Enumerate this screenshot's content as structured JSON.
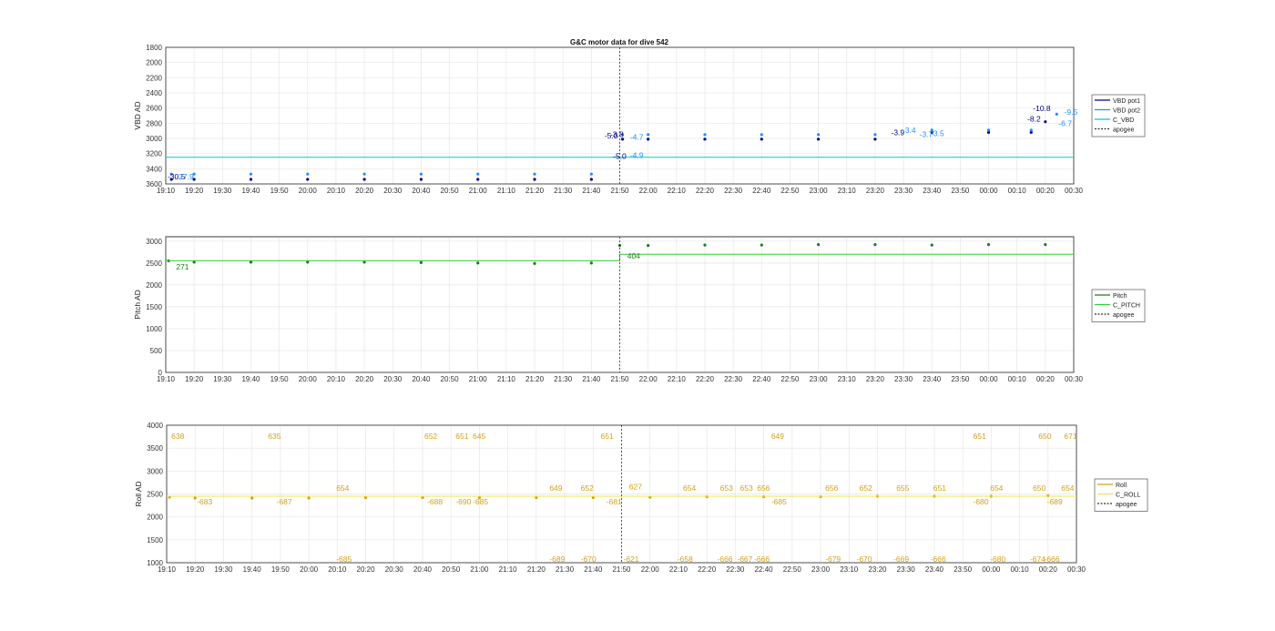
{
  "figure": {
    "title": "G&C motor data for dive 542"
  },
  "chart_data": [
    {
      "type": "line",
      "title": "G&C motor data for dive 542",
      "ylabel": "VBD AD",
      "xlabel": "",
      "x_ticks": [
        "19:10",
        "19:20",
        "19:30",
        "19:40",
        "19:50",
        "20:00",
        "20:10",
        "20:20",
        "20:30",
        "20:40",
        "20:50",
        "21:00",
        "21:10",
        "21:20",
        "21:30",
        "21:40",
        "21:50",
        "22:00",
        "22:10",
        "22:20",
        "22:30",
        "22:40",
        "22:50",
        "23:00",
        "23:10",
        "23:20",
        "23:30",
        "23:40",
        "23:50",
        "00:00",
        "00:10",
        "00:20",
        "00:30"
      ],
      "y_ticks": [
        "1800",
        "2000",
        "2200",
        "2400",
        "2600",
        "2800",
        "3000",
        "3200",
        "3400",
        "3600"
      ],
      "ylim": [
        1800,
        3600
      ],
      "y_reversed": true,
      "grid": true,
      "legend_position": "outside-right",
      "legend": [
        {
          "label": "VBD pot1",
          "color": "#00008b",
          "style": "solid"
        },
        {
          "label": "VBD pot2",
          "color": "#1e90ff",
          "style": "solid"
        },
        {
          "label": "C_VBD",
          "color": "#00cccc",
          "style": "solid"
        },
        {
          "label": "apogee",
          "color": "#333333",
          "style": "dotted"
        }
      ],
      "series": [
        {
          "name": "VBD pot1",
          "color": "#00008b",
          "x": [
            "19:12",
            "19:20",
            "19:40",
            "20:00",
            "20:20",
            "20:40",
            "21:00",
            "21:20",
            "21:40",
            "21:51",
            "22:00",
            "22:20",
            "22:40",
            "23:00",
            "23:20",
            "23:40",
            "00:00",
            "00:15",
            "00:20"
          ],
          "values": [
            3540,
            3540,
            3540,
            3540,
            3540,
            3540,
            3540,
            3540,
            3540,
            3010,
            3010,
            3010,
            3010,
            3010,
            3010,
            2920,
            2920,
            2920,
            2780
          ]
        },
        {
          "name": "VBD pot2",
          "color": "#1e90ff",
          "x": [
            "19:12",
            "19:20",
            "19:40",
            "20:00",
            "20:20",
            "20:40",
            "21:00",
            "21:20",
            "21:40",
            "21:51",
            "22:00",
            "22:20",
            "22:40",
            "23:00",
            "23:20",
            "23:40",
            "00:00",
            "00:15",
            "00:24"
          ],
          "values": [
            3470,
            3470,
            3470,
            3470,
            3470,
            3470,
            3470,
            3470,
            3470,
            2950,
            2950,
            2950,
            2950,
            2950,
            2950,
            2890,
            2890,
            2890,
            2680
          ]
        },
        {
          "name": "C_VBD",
          "color": "#00cccc",
          "x": [
            "19:10",
            "00:30"
          ],
          "values": [
            3250,
            3250
          ]
        }
      ],
      "apogee": "21:50",
      "annotations": [
        {
          "text": "-30.5",
          "x": "19:10",
          "y": 3540,
          "color": "#00008b"
        },
        {
          "text": "-27.9",
          "x": "19:13",
          "y": 3540,
          "color": "#1e90ff"
        },
        {
          "text": "-5.0",
          "x": "21:47",
          "y": 3270,
          "color": "#00008b"
        },
        {
          "text": "-3.8",
          "x": "21:46",
          "y": 2980,
          "color": "#00008b"
        },
        {
          "text": "-5.0",
          "x": "21:44",
          "y": 3000,
          "color": "#00008b"
        },
        {
          "text": "-4.7",
          "x": "21:53",
          "y": 3020,
          "color": "#1e90ff"
        },
        {
          "text": "-4.9",
          "x": "21:53",
          "y": 3260,
          "color": "#1e90ff"
        },
        {
          "text": "-3.9",
          "x": "23:25",
          "y": 2960,
          "color": "#00008b"
        },
        {
          "text": "-3.4",
          "x": "23:29",
          "y": 2930,
          "color": "#1e90ff"
        },
        {
          "text": "-3.7",
          "x": "23:35",
          "y": 2980,
          "color": "#1e90ff"
        },
        {
          "text": "-3.5",
          "x": "23:39",
          "y": 2970,
          "color": "#1e90ff"
        },
        {
          "text": "-8.2",
          "x": "00:13",
          "y": 2780,
          "color": "#00008b"
        },
        {
          "text": "-10.8",
          "x": "00:15",
          "y": 2640,
          "color": "#00008b"
        },
        {
          "text": "-6.7",
          "x": "00:24",
          "y": 2840,
          "color": "#1e90ff"
        },
        {
          "text": "-9.5",
          "x": "00:26",
          "y": 2690,
          "color": "#1e90ff"
        }
      ]
    },
    {
      "type": "line",
      "title": "",
      "ylabel": "Pitch AD",
      "xlabel": "",
      "x_ticks": [
        "19:10",
        "19:20",
        "19:30",
        "19:40",
        "19:50",
        "20:00",
        "20:10",
        "20:20",
        "20:30",
        "20:40",
        "20:50",
        "21:00",
        "21:10",
        "21:20",
        "21:30",
        "21:40",
        "21:50",
        "22:00",
        "22:10",
        "22:20",
        "22:30",
        "22:40",
        "22:50",
        "23:00",
        "23:10",
        "23:20",
        "23:30",
        "23:40",
        "23:50",
        "00:00",
        "00:10",
        "00:20",
        "00:30"
      ],
      "y_ticks": [
        "0",
        "500",
        "1000",
        "1500",
        "2000",
        "2500",
        "3000"
      ],
      "ylim": [
        0,
        3100
      ],
      "grid": true,
      "legend_position": "outside-right",
      "legend": [
        {
          "label": "Pitch",
          "color": "#1a7f1a",
          "style": "solid"
        },
        {
          "label": "C_PITCH",
          "color": "#32cd32",
          "style": "solid"
        },
        {
          "label": "apogee",
          "color": "#333333",
          "style": "dotted"
        }
      ],
      "series": [
        {
          "name": "Pitch",
          "color": "#1a7f1a",
          "x": [
            "19:11",
            "19:20",
            "19:40",
            "20:00",
            "20:20",
            "20:40",
            "21:00",
            "21:20",
            "21:40",
            "21:50",
            "22:00",
            "22:20",
            "22:40",
            "23:00",
            "23:20",
            "23:40",
            "00:00",
            "00:20"
          ],
          "values": [
            2550,
            2520,
            2520,
            2520,
            2520,
            2510,
            2500,
            2490,
            2500,
            2900,
            2900,
            2910,
            2910,
            2920,
            2920,
            2910,
            2920,
            2920
          ]
        },
        {
          "name": "C_PITCH",
          "color": "#32cd32",
          "x": [
            "19:10",
            "21:50",
            "21:50",
            "00:30"
          ],
          "values": [
            2550,
            2550,
            2700,
            2700
          ]
        }
      ],
      "apogee": "21:50",
      "annotations": [
        {
          "text": "271",
          "x": "19:13",
          "y": 2350,
          "color": "#1a7f1a"
        },
        {
          "text": "404",
          "x": "21:52",
          "y": 2600,
          "color": "#1a7f1a"
        }
      ]
    },
    {
      "type": "line",
      "title": "",
      "ylabel": "Roll AD",
      "xlabel": "",
      "x_ticks": [
        "19:10",
        "19:20",
        "19:30",
        "19:40",
        "19:50",
        "20:00",
        "20:10",
        "20:20",
        "20:30",
        "20:40",
        "20:50",
        "21:00",
        "21:10",
        "21:20",
        "21:30",
        "21:40",
        "21:50",
        "22:00",
        "22:10",
        "22:20",
        "22:30",
        "22:40",
        "22:50",
        "23:00",
        "23:10",
        "23:20",
        "23:30",
        "23:40",
        "23:50",
        "00:00",
        "00:10",
        "00:20",
        "00:30"
      ],
      "y_ticks": [
        "1000",
        "1500",
        "2000",
        "2500",
        "3000",
        "3500",
        "4000"
      ],
      "ylim": [
        1000,
        4000
      ],
      "grid": true,
      "legend_position": "outside-right",
      "legend": [
        {
          "label": "Roll",
          "color": "#d4a017",
          "style": "solid"
        },
        {
          "label": "C_ROLL",
          "color": "#f5e050",
          "style": "solid"
        },
        {
          "label": "apogee",
          "color": "#333333",
          "style": "dotted"
        }
      ],
      "series": [
        {
          "name": "Roll",
          "color": "#d4a017",
          "x": [
            "19:11",
            "19:20",
            "19:40",
            "20:00",
            "20:20",
            "20:40",
            "21:00",
            "21:20",
            "21:40",
            "22:00",
            "22:20",
            "22:40",
            "23:00",
            "23:20",
            "23:40",
            "00:00",
            "00:20"
          ],
          "values": [
            2430,
            2410,
            2410,
            2410,
            2420,
            2420,
            2420,
            2420,
            2420,
            2430,
            2440,
            2440,
            2440,
            2450,
            2450,
            2450,
            2460
          ]
        },
        {
          "name": "C_ROLL",
          "color": "#f5e050",
          "x": [
            "19:10",
            "00:30"
          ],
          "values": [
            2450,
            2450
          ]
        }
      ],
      "apogee": "21:50",
      "annotations": [
        {
          "text": "638",
          "x": "19:11",
          "y": 3700
        },
        {
          "text": "-683",
          "x": "19:20",
          "y": 2270
        },
        {
          "text": "635",
          "x": "19:45",
          "y": 3700
        },
        {
          "text": "-687",
          "x": "19:48",
          "y": 2270
        },
        {
          "text": "654",
          "x": "20:09",
          "y": 2570
        },
        {
          "text": "-685",
          "x": "20:09",
          "y": 1020
        },
        {
          "text": "652",
          "x": "20:40",
          "y": 3700
        },
        {
          "text": "-688",
          "x": "20:41",
          "y": 2270
        },
        {
          "text": "651",
          "x": "20:51",
          "y": 3700
        },
        {
          "text": "645",
          "x": "20:57",
          "y": 3700
        },
        {
          "text": "-690",
          "x": "20:51",
          "y": 2270
        },
        {
          "text": "-685",
          "x": "20:57",
          "y": 2270
        },
        {
          "text": "649",
          "x": "21:24",
          "y": 2570
        },
        {
          "text": "-689",
          "x": "21:24",
          "y": 1020
        },
        {
          "text": "652",
          "x": "21:35",
          "y": 2570
        },
        {
          "text": "-670",
          "x": "21:35",
          "y": 1020
        },
        {
          "text": "651",
          "x": "21:42",
          "y": 3700
        },
        {
          "text": "-681",
          "x": "21:44",
          "y": 2270
        },
        {
          "text": "-621",
          "x": "21:50",
          "y": 1020
        },
        {
          "text": "627",
          "x": "21:52",
          "y": 2600
        },
        {
          "text": "654",
          "x": "22:11",
          "y": 2570
        },
        {
          "text": "-658",
          "x": "22:09",
          "y": 1020
        },
        {
          "text": "653",
          "x": "22:24",
          "y": 2570
        },
        {
          "text": "-666",
          "x": "22:23",
          "y": 1020
        },
        {
          "text": "653",
          "x": "22:31",
          "y": 2570
        },
        {
          "text": "-667",
          "x": "22:30",
          "y": 1020
        },
        {
          "text": "656",
          "x": "22:37",
          "y": 2570
        },
        {
          "text": "-666",
          "x": "22:36",
          "y": 1020
        },
        {
          "text": "649",
          "x": "22:42",
          "y": 3700
        },
        {
          "text": "-685",
          "x": "22:42",
          "y": 2270
        },
        {
          "text": "656",
          "x": "23:01",
          "y": 2570
        },
        {
          "text": "-679",
          "x": "23:01",
          "y": 1020
        },
        {
          "text": "652",
          "x": "23:13",
          "y": 2570
        },
        {
          "text": "-670",
          "x": "23:12",
          "y": 1020
        },
        {
          "text": "655",
          "x": "23:26",
          "y": 2570
        },
        {
          "text": "-669",
          "x": "23:25",
          "y": 1020
        },
        {
          "text": "651",
          "x": "23:39",
          "y": 2570
        },
        {
          "text": "-666",
          "x": "23:38",
          "y": 1020
        },
        {
          "text": "651",
          "x": "23:53",
          "y": 3700
        },
        {
          "text": "-680",
          "x": "23:53",
          "y": 2270
        },
        {
          "text": "654",
          "x": "23:59",
          "y": 2570
        },
        {
          "text": "-680",
          "x": "23:59",
          "y": 1020
        },
        {
          "text": "650",
          "x": "00:16",
          "y": 3700
        },
        {
          "text": "-674",
          "x": "00:13",
          "y": 1020
        },
        {
          "text": "650",
          "x": "00:14",
          "y": 2570
        },
        {
          "text": "-689",
          "x": "00:19",
          "y": 2270
        },
        {
          "text": "-666",
          "x": "00:18",
          "y": 1020
        },
        {
          "text": "671",
          "x": "00:25",
          "y": 3700
        },
        {
          "text": "654",
          "x": "00:24",
          "y": 2570
        }
      ]
    }
  ]
}
